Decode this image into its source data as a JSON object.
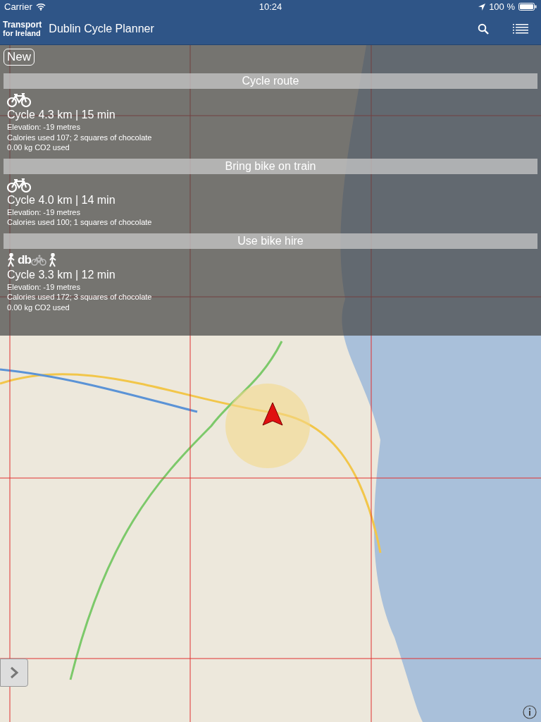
{
  "status_bar": {
    "carrier": "Carrier",
    "time": "10:24",
    "battery": "100 %"
  },
  "nav_bar": {
    "logo_top": "Transport",
    "logo_bottom": "for Ireland",
    "title": "Dublin Cycle Planner"
  },
  "panel": {
    "new_button": "New",
    "routes": [
      {
        "header": "Cycle route",
        "icons": [
          {
            "kind": "bike"
          }
        ],
        "summary": "Cycle 4.3 km | 15 min",
        "details": [
          "Elevation: -19 metres",
          "Calories used 107; 2 squares of chocolate",
          "0.00 kg CO2 used"
        ]
      },
      {
        "header": "Bring bike on train",
        "icons": [
          {
            "kind": "bike"
          }
        ],
        "summary": "Cycle 4.0 km | 14 min",
        "details": [
          "Elevation: -19 metres",
          "Calories used 100; 1 squares of chocolate"
        ]
      },
      {
        "header": "Use bike hire",
        "icons": [
          {
            "kind": "walk"
          },
          {
            "kind": "hire",
            "text": "db"
          },
          {
            "kind": "walk"
          }
        ],
        "summary": "Cycle 3.3 km | 12 min",
        "details": [
          "Elevation: -19 metres",
          "Calories used 172; 3 squares of chocolate",
          "0.00 kg CO2 used"
        ]
      }
    ]
  }
}
